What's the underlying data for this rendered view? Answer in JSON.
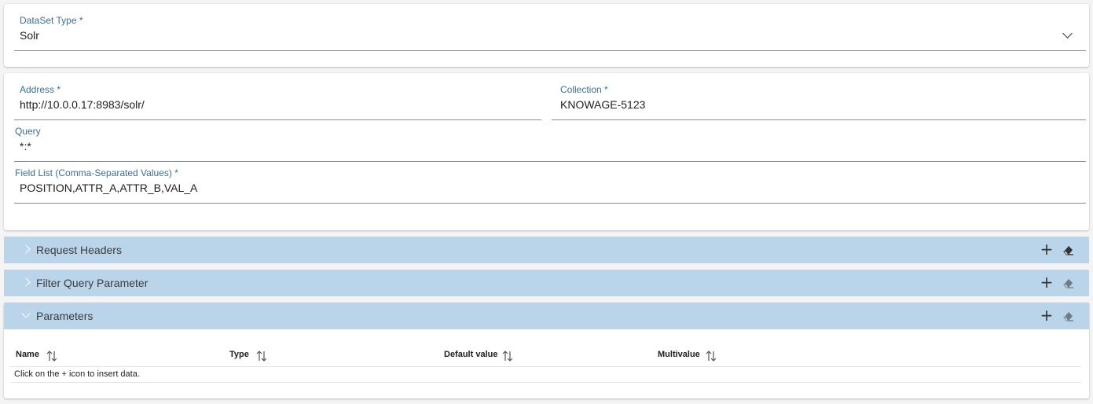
{
  "dataset_type": {
    "label": "DataSet Type *",
    "value": "Solr"
  },
  "form": {
    "address": {
      "label": "Address *",
      "value": "http://10.0.0.17:8983/solr/"
    },
    "collection": {
      "label": "Collection *",
      "value": "KNOWAGE-5123"
    },
    "query": {
      "label": "Query",
      "value": "*:*"
    },
    "field_list": {
      "label": "Field List (Comma-Separated Values) *",
      "value": "POSITION,ATTR_A,ATTR_B,VAL_A"
    }
  },
  "panels": [
    {
      "title": "Request Headers",
      "expanded": false,
      "add_icon": "plus-icon",
      "clear_icon": "eraser-icon"
    },
    {
      "title": "Filter Query Parameter",
      "expanded": false,
      "add_icon": "plus-icon",
      "clear_icon": "eraser-icon"
    },
    {
      "title": "Parameters",
      "expanded": true,
      "add_icon": "plus-icon",
      "clear_icon": "eraser-icon"
    }
  ],
  "parameters_table": {
    "columns": [
      "Name",
      "Type",
      "Default value",
      "Multivalue"
    ],
    "empty_message": "Click on the + icon to insert data."
  },
  "colors": {
    "panel_header": "#bad4ea",
    "label": "#3c6e99"
  }
}
